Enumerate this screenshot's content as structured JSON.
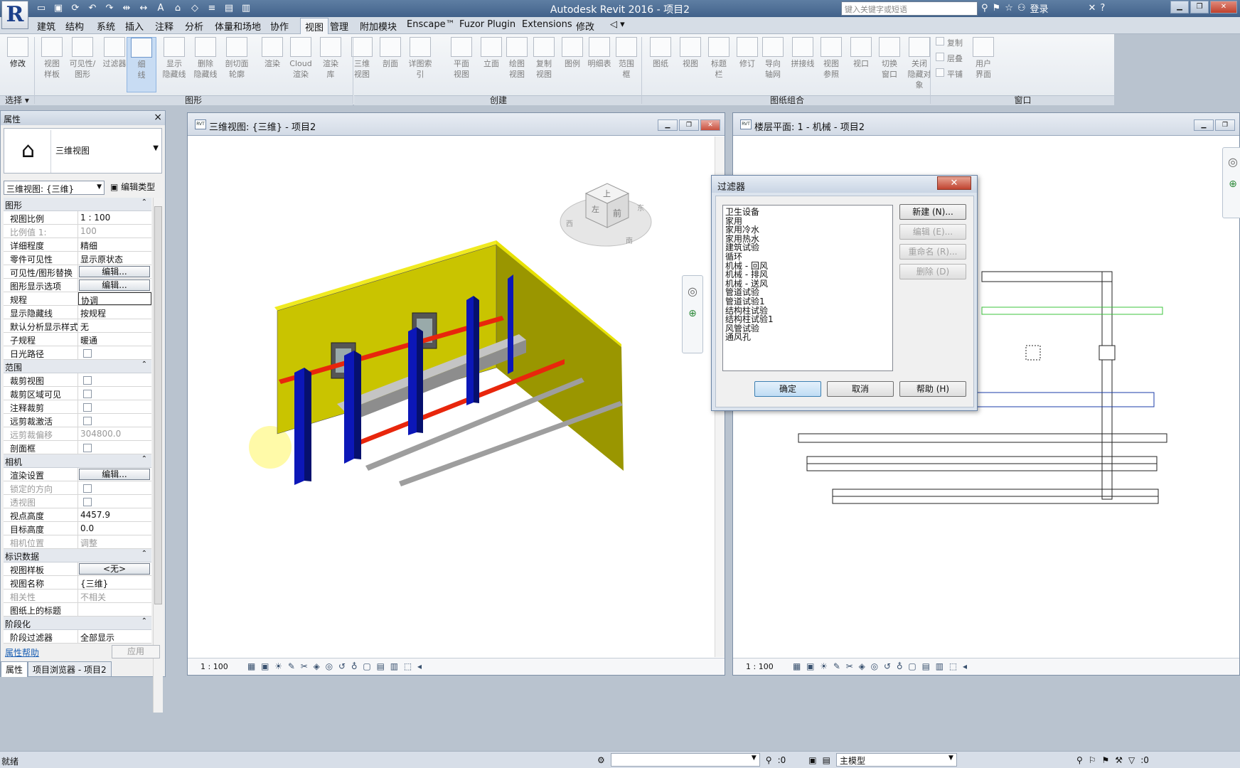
{
  "app": {
    "title": "Autodesk Revit 2016 -    项目2",
    "search_placeholder": "键入关键字或短语",
    "login": "登录",
    "qat_icons": [
      "open-icon",
      "save-icon",
      "sync-icon",
      "undo-icon",
      "redo-icon",
      "measure-icon",
      "dimension-icon",
      "text-icon",
      "3d-icon",
      "section-icon",
      "thin-lines-icon",
      "close-hidden-icon",
      "switch-windows-icon"
    ]
  },
  "tabs": [
    "建筑",
    "结构",
    "系统",
    "插入",
    "注释",
    "分析",
    "体量和场地",
    "协作",
    "视图",
    "管理",
    "附加模块",
    "Enscape™",
    "Fuzor Plugin",
    "Extensions",
    "修改"
  ],
  "active_tab": "视图",
  "ribbon": {
    "tools": [
      "修改",
      "视图\n样板",
      "可见性/\n图形",
      "过滤器",
      "细\n线",
      "显示\n隐藏线",
      "删除\n隐藏线",
      "剖切面\n轮廓",
      "渲染",
      "Cloud\n渲染",
      "渲染\n库",
      "三维\n视图",
      "剖面",
      "详图索引",
      "平面\n视图",
      "立面",
      "绘图\n视图",
      "复制\n视图",
      "图例",
      "明细表",
      "范围\n框",
      "图纸",
      "视图",
      "标题\n栏",
      "修订",
      "导向\n轴网",
      "拼接线",
      "视图\n参照",
      "视口",
      "切换\n窗口",
      "关闭\n隐藏对象",
      "复制",
      "层叠",
      "平铺",
      "用户\n界面"
    ],
    "groups": [
      "选择 ▾",
      "图形",
      "创建",
      "图纸组合",
      "窗口"
    ]
  },
  "properties": {
    "header": "属性",
    "type_name": "三维视图",
    "view_selector": "三维视图: {三维}",
    "edit_type": "编辑类型",
    "sections": [
      {
        "name": "图形",
        "rows": [
          [
            "视图比例",
            "1 : 100",
            "text"
          ],
          [
            "比例值 1:",
            "100",
            "dim"
          ],
          [
            "详细程度",
            "精细",
            "text"
          ],
          [
            "零件可见性",
            "显示原状态",
            "text"
          ],
          [
            "可见性/图形替换",
            "编辑...",
            "btn"
          ],
          [
            "图形显示选项",
            "编辑...",
            "btn"
          ],
          [
            "规程",
            "协调",
            "input"
          ],
          [
            "显示隐藏线",
            "按规程",
            "text"
          ],
          [
            "默认分析显示样式",
            "无",
            "text"
          ],
          [
            "子规程",
            "暖通",
            "text"
          ],
          [
            "日光路径",
            "",
            "cb"
          ]
        ]
      },
      {
        "name": "范围",
        "rows": [
          [
            "裁剪视图",
            "",
            "cb"
          ],
          [
            "裁剪区域可见",
            "",
            "cb"
          ],
          [
            "注释裁剪",
            "",
            "cb"
          ],
          [
            "远剪裁激活",
            "",
            "cb"
          ],
          [
            "远剪裁偏移",
            "304800.0",
            "dim"
          ],
          [
            "剖面框",
            "",
            "cb"
          ]
        ]
      },
      {
        "name": "相机",
        "rows": [
          [
            "渲染设置",
            "编辑...",
            "btn"
          ],
          [
            "锁定的方向",
            "",
            "cbdim"
          ],
          [
            "透视图",
            "",
            "cbdim"
          ],
          [
            "视点高度",
            "4457.9",
            "text"
          ],
          [
            "目标高度",
            "0.0",
            "text"
          ],
          [
            "相机位置",
            "调整",
            "dim"
          ]
        ]
      },
      {
        "name": "标识数据",
        "rows": [
          [
            "视图样板",
            "<无>",
            "btn"
          ],
          [
            "视图名称",
            "{三维}",
            "text"
          ],
          [
            "相关性",
            "不相关",
            "dim"
          ],
          [
            "图纸上的标题",
            "",
            "text"
          ]
        ]
      },
      {
        "name": "阶段化",
        "rows": [
          [
            "阶段过滤器",
            "全部显示",
            "text"
          ]
        ]
      }
    ],
    "help_link": "属性帮助",
    "apply_label": "应用",
    "bottom_tabs": [
      "属性",
      "项目浏览器 - 项目2"
    ]
  },
  "view3d": {
    "title": "三维视图: {三维} - 项目2",
    "scale": "1 : 100",
    "viewcube": {
      "top": "上",
      "front": "前",
      "left": "左",
      "east": "东",
      "south": "南",
      "west": "西"
    }
  },
  "plan": {
    "title": "楼层平面: 1 - 机械 - 项目2",
    "scale": "1 : 100"
  },
  "view_controls_icons": "▦ ▣ ☀ ✎ ✂ ◈ ◎ ↺ ♁ ▢ ▤ ▥ ⬚ ◂",
  "filter_dialog": {
    "title": "过滤器",
    "items": [
      "卫生设备",
      "家用",
      "家用冷水",
      "家用热水",
      "建筑试验",
      "循环",
      "机械 - 回风",
      "机械 - 排风",
      "机械 - 送风",
      "管道试验",
      "管道试验1",
      "结构柱试验",
      "结构柱试验1",
      "风管试验",
      "通风孔"
    ],
    "buttons": [
      "新建 (N)...",
      "编辑 (E)...",
      "重命名 (R)...",
      "删除 (D)"
    ],
    "ok": "确定",
    "cancel": "取消",
    "help": "帮助 (H)"
  },
  "status": {
    "text": "就绪",
    "zero": ":0",
    "model": "主模型",
    "filter_count": ":0"
  },
  "colors": {
    "wall": "#c9c400",
    "column": "#0c17b8",
    "pipe_red": "#e8260c",
    "duct_gray": "#a9a9a9",
    "highlight": "#fffaa8"
  }
}
